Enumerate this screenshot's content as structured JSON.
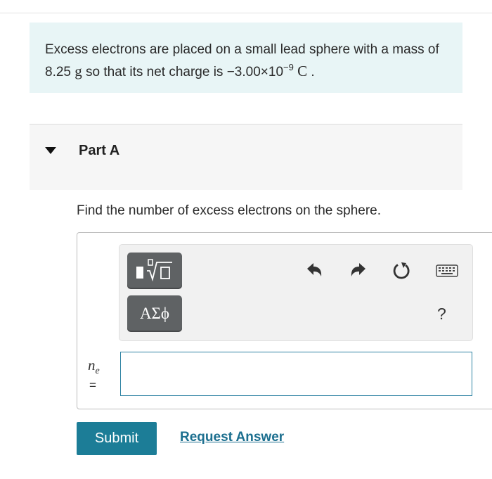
{
  "problem": {
    "text_before": "Excess electrons are placed on a small lead sphere with a mass of 8.25 ",
    "mass_unit": "g",
    "text_middle": " so that its net charge is −3.00×10",
    "exponent": "−9",
    "charge_unit": "C",
    "text_end": " ."
  },
  "part": {
    "title": "Part A",
    "caret_icon": "caret-down-icon"
  },
  "question": "Find the number of excess electrons on the sphere.",
  "toolbar": {
    "templates_icon": "templates-icon",
    "greek_label": "ΑΣϕ",
    "undo_icon": "undo-icon",
    "redo_icon": "redo-icon",
    "reset_icon": "reset-icon",
    "keyboard_icon": "keyboard-icon",
    "help_label": "?"
  },
  "answer": {
    "variable": "n",
    "subscript": "e",
    "equals": "=",
    "value": ""
  },
  "actions": {
    "submit_label": "Submit",
    "request_label": "Request Answer"
  },
  "colors": {
    "problem_bg": "#e8f5f6",
    "accent": "#1c7d97",
    "input_border": "#2e83a3"
  }
}
